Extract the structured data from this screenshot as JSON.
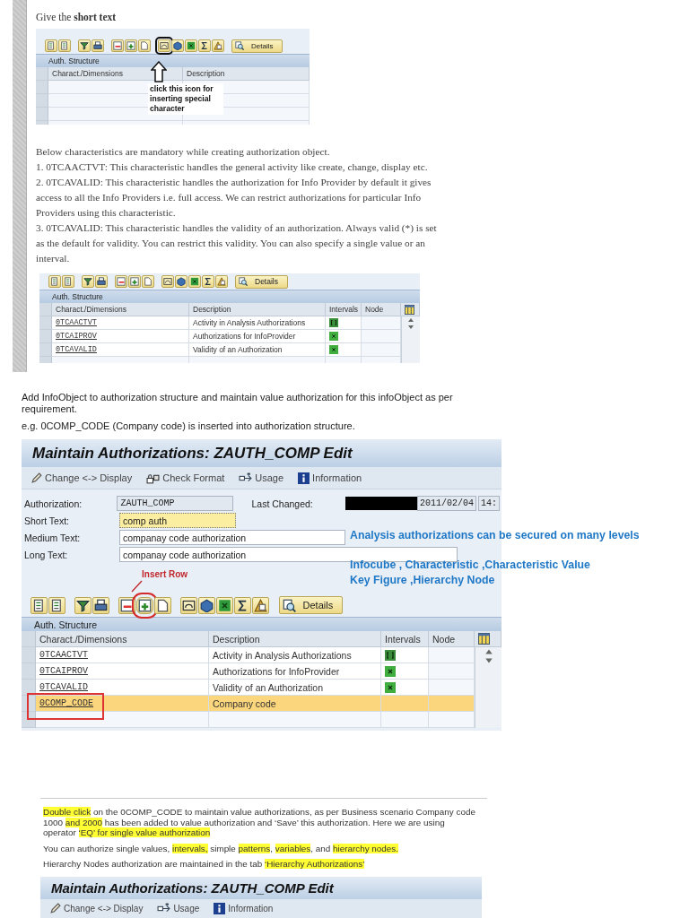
{
  "section_one": {
    "intro": "Give the **short text**",
    "small_panel": {
      "toolbar_button": "Details",
      "header": "Auth. Structure",
      "columns": [
        "Charact./Dimensions",
        "Description"
      ],
      "callout": "click this icon for inserting special character"
    },
    "paragraphs": [
      "Below characteristics are mandatory while creating authorization object.",
      "1. 0TCAACTVT: This characteristic handles the general activity like create, change, display etc.",
      "2. 0TCAVALID: This characteristic handles the authorization for Info Provider by default it gives access to all the Info Providers i.e. full access. We can restrict authorizations for particular Info Providers using this characteristic.",
      "3. 0TCAVALID:  This characteristic handles the validity of an authorization. Always valid (*) is set as the default for validity. You can restrict this validity. You can also specify a single value or an interval."
    ],
    "table_panel": {
      "toolbar_button": "Details",
      "header": "Auth. Structure",
      "columns": [
        "Charact./Dimensions",
        "Description",
        "Intervals",
        "Node"
      ],
      "rows": [
        {
          "code": "0TCAACTVT",
          "description": "Activity in Analysis Authorizations",
          "kind": "range"
        },
        {
          "code": "0TCAIPROV",
          "description": "Authorizations for InfoProvider",
          "kind": "all"
        },
        {
          "code": "0TCAVALID",
          "description": "Validity of an Authorization",
          "kind": "all"
        }
      ]
    }
  },
  "section_two": {
    "intro": [
      "Add InfoObject to authorization structure and maintain value authorization for this infoObject as per requirement.",
      "e.g. 0COMP_CODE (Company code) is inserted into authorization structure."
    ],
    "window": {
      "title": "Maintain Authorizations: ZAUTH_COMP Edit",
      "actions": [
        "Change <-> Display",
        "Check Format",
        "Usage",
        "Information"
      ],
      "fields": [
        {
          "label": "Authorization:",
          "value": "ZAUTH_COMP",
          "kind": "readonly"
        },
        {
          "label": "Short Text:",
          "value": "comp auth",
          "kind": "focused"
        },
        {
          "label": "Medium Text:",
          "value": "companay code authorization",
          "kind": "medium"
        },
        {
          "label": "Long Text:",
          "value": "companay code authorization",
          "kind": "long"
        }
      ],
      "last_changed": {
        "label": "Last Changed:",
        "date": "2011/02/04",
        "time": "14:"
      },
      "annotation": "Insert Row",
      "toolbar_button": "Details",
      "header": "Auth. Structure",
      "columns": [
        "Charact./Dimensions",
        "Description",
        "Intervals",
        "Node"
      ],
      "rows": [
        {
          "code": "0TCAACTVT",
          "description": "Activity in Analysis Authorizations",
          "kind": "range",
          "selected": false,
          "marked": false
        },
        {
          "code": "0TCAIPROV",
          "description": "Authorizations for InfoProvider",
          "kind": "all",
          "selected": false,
          "marked": false
        },
        {
          "code": "0TCAVALID",
          "description": "Validity of an Authorization",
          "kind": "all",
          "selected": false,
          "marked": false
        },
        {
          "code": "0COMP_CODE",
          "description": "Company code",
          "kind": "none",
          "selected": true,
          "marked": true
        }
      ]
    },
    "notes": [
      "Analysis authorizations can be secured on many levels",
      "Infocube , Characteristic ,Characteristic Value",
      "Key Figure ,Hierarchy Node"
    ]
  },
  "section_three": {
    "paragraphs": [
      [
        {
          "text": "Double click",
          "highlight": true
        },
        {
          "text": " on the 0COMP_CODE to maintain value authorizations, as per Business scenario Company code 1000 ",
          "highlight": false
        },
        {
          "text": "and 2000",
          "highlight": true
        },
        {
          "text": " has been added to value authorization and ‘Save’ this authorization. Here we are using operator ",
          "highlight": false
        },
        {
          "text": "‘EQ’ for single value authorization",
          "highlight": true
        }
      ],
      [
        {
          "text": "You can authorize single values, ",
          "highlight": false
        },
        {
          "text": "intervals,",
          "highlight": true
        },
        {
          "text": " simple ",
          "highlight": false
        },
        {
          "text": "patterns",
          "highlight": true
        },
        {
          "text": ", ",
          "highlight": false
        },
        {
          "text": "variables",
          "highlight": true
        },
        {
          "text": ", and ",
          "highlight": false
        },
        {
          "text": "hierarchy nodes.",
          "highlight": true
        }
      ],
      [
        {
          "text": "Hierarchy Nodes authorization are maintained in the tab ",
          "highlight": false
        },
        {
          "text": "‘Hierarchy Authorizations’",
          "highlight": true
        }
      ]
    ],
    "window": {
      "title": "Maintain Authorizations: ZAUTH_COMP Edit",
      "actions": [
        "Change <-> Display",
        "Usage",
        "Information"
      ]
    }
  }
}
